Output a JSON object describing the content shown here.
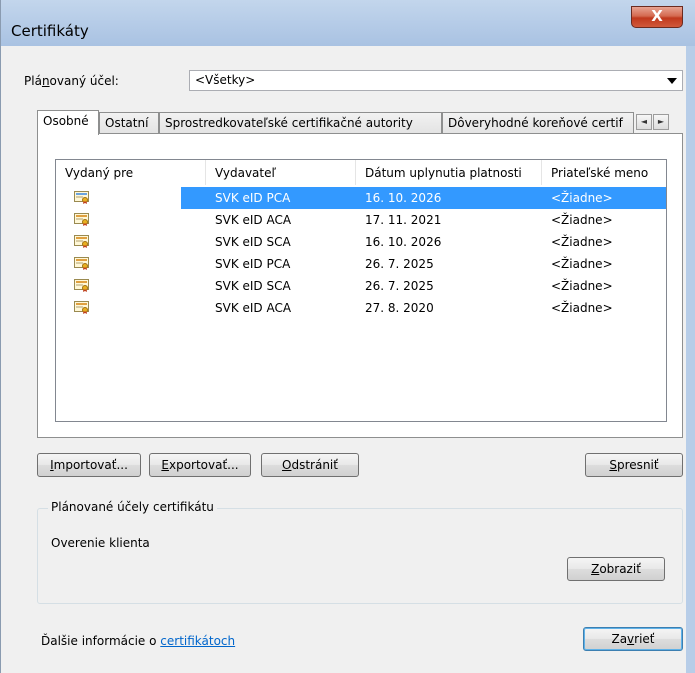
{
  "window": {
    "title": "Certifikáty",
    "close_label": "X"
  },
  "purpose": {
    "label_prefix": "Plá",
    "label_mnemonic": "n",
    "label_suffix": "ovaný účel:",
    "selected": "<Všetky>"
  },
  "tabs": [
    {
      "label": "Osobné"
    },
    {
      "label": "Ostatní"
    },
    {
      "label": "Sprostredkovateľské certifikačné autority"
    },
    {
      "label": "Dôveryhodné koreňové certif"
    }
  ],
  "tab_scroll": {
    "left": "◄",
    "right": "►"
  },
  "list": {
    "columns": [
      "Vydaný pre",
      "Vydavateľ",
      "Dátum uplynutia platnosti",
      "Priateľské meno"
    ],
    "rows": [
      {
        "issued_to": "",
        "issuer": "SVK eID PCA",
        "expires": "16. 10. 2026",
        "friendly": "<Žiadne>",
        "selected": true
      },
      {
        "issued_to": "",
        "issuer": "SVK eID ACA",
        "expires": "17. 11. 2021",
        "friendly": "<Žiadne>"
      },
      {
        "issued_to": "",
        "issuer": "SVK eID SCA",
        "expires": "16. 10. 2026",
        "friendly": "<Žiadne>"
      },
      {
        "issued_to": "",
        "issuer": "SVK eID PCA",
        "expires": "26. 7. 2025",
        "friendly": "<Žiadne>"
      },
      {
        "issued_to": "",
        "issuer": "SVK eID SCA",
        "expires": "26. 7. 2025",
        "friendly": "<Žiadne>"
      },
      {
        "issued_to": "",
        "issuer": "SVK eID ACA",
        "expires": "27. 8. 2020",
        "friendly": "<Žiadne>"
      }
    ],
    "row_icon": "certificate-icon"
  },
  "buttons": {
    "import": {
      "mnemonic": "I",
      "rest": "mportovať..."
    },
    "export": {
      "mnemonic": "E",
      "rest": "xportovať..."
    },
    "remove": {
      "mnemonic": "O",
      "rest": "dstrániť"
    },
    "advanced": {
      "mnemonic": "S",
      "rest": "presniť"
    },
    "view": {
      "mnemonic": "Z",
      "rest": "obraziť"
    },
    "close": {
      "pre": "Za",
      "mnemonic": "v",
      "rest": "rieť"
    }
  },
  "purposes_group": {
    "title": "Plánované účely certifikátu",
    "value": "Overenie klienta"
  },
  "info": {
    "text": "Ďalšie informácie o ",
    "link": "certifikátoch"
  },
  "colors": {
    "selection": "#3399ff",
    "link": "#0066cc",
    "close_button": "#c0391d"
  }
}
